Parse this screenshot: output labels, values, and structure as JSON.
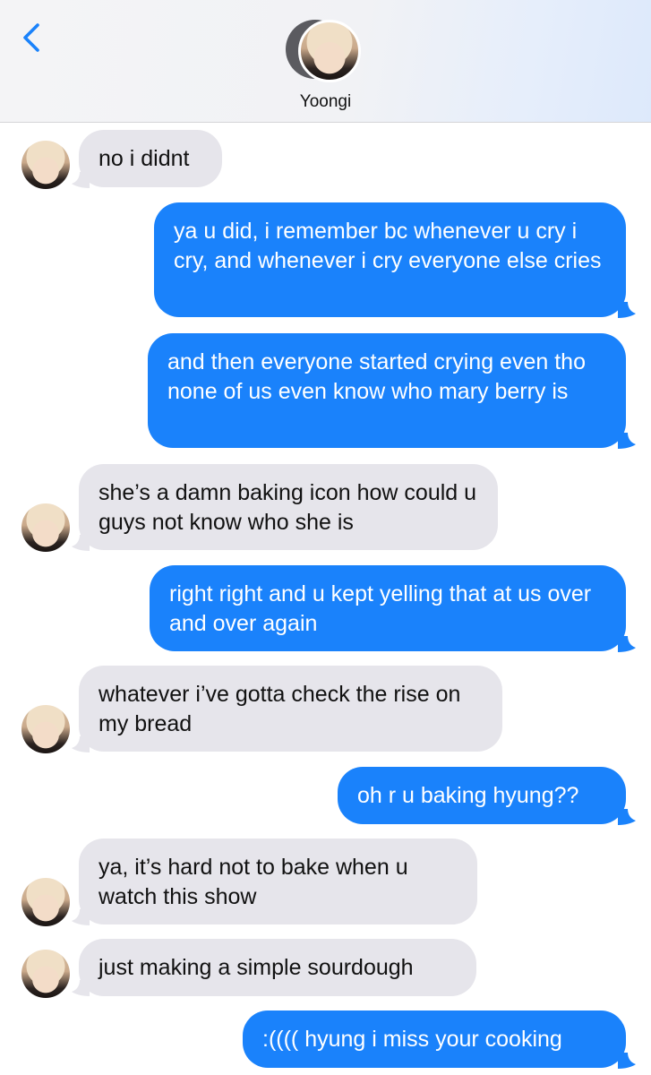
{
  "header": {
    "contact_name": "Yoongi",
    "back_icon": "chevron-left-icon",
    "accent_color": "#1a82fb"
  },
  "messages": [
    {
      "direction": "incoming",
      "text": "no i didnt",
      "avatar": true
    },
    {
      "direction": "outgoing",
      "text": "ya u did, i remember bc whenever u cry i cry, and whenever i cry everyone else cries"
    },
    {
      "direction": "outgoing",
      "text": "and then everyone started crying even tho none of us even know who mary berry is"
    },
    {
      "direction": "incoming",
      "text": "she’s a damn baking icon how could u guys not know who she is",
      "avatar": true
    },
    {
      "direction": "outgoing",
      "text": "right right and u kept yelling that at us over and over again"
    },
    {
      "direction": "incoming",
      "text": "whatever i’ve gotta check the rise on my bread",
      "avatar": true
    },
    {
      "direction": "outgoing",
      "text": "oh r u baking hyung??"
    },
    {
      "direction": "incoming",
      "text": "ya, it’s hard not to bake when u watch this show",
      "avatar": true
    },
    {
      "direction": "incoming",
      "text": "just making a simple sourdough",
      "avatar": true
    },
    {
      "direction": "outgoing",
      "text": ":(((( hyung i miss your cooking"
    }
  ],
  "colors": {
    "incoming_bubble": "#e6e5eb",
    "outgoing_bubble": "#1a82fb"
  }
}
